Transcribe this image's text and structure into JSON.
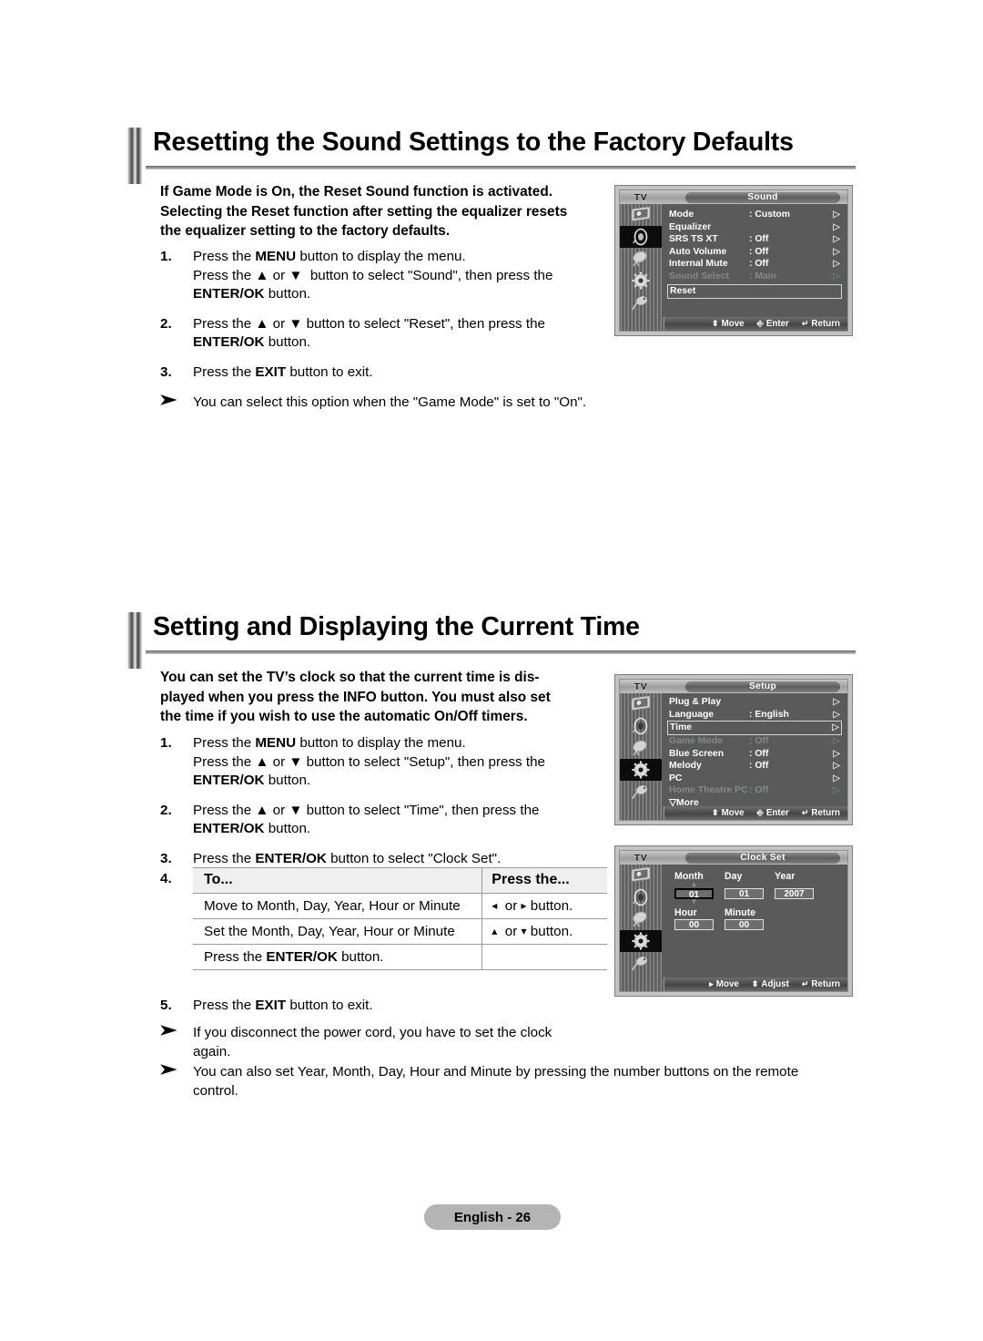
{
  "page": {
    "footer_label": "English - 26"
  },
  "sections": [
    {
      "title": "Resetting the Sound Settings to the Factory Defaults",
      "intro": "If Game Mode is On, the Reset Sound function is activated. Selecting the Reset function after setting the equalizer resets the equalizer setting to the factory defaults.",
      "steps": [
        {
          "num": "1.",
          "line1": "Press the MENU button to display the menu.",
          "line2": "Press the ▲ or ▼  button to select \"Sound\", then press the",
          "line3": "ENTER/OK button."
        },
        {
          "num": "2.",
          "line1": "Press the ▲ or ▼ button to select \"Reset\", then press the",
          "line2": "ENTER/OK button."
        },
        {
          "num": "3.",
          "line1": "Press the EXIT button to exit."
        }
      ],
      "notes": [
        "You can select this option when the \"Game Mode\" is set to \"On\"."
      ]
    },
    {
      "title": "Setting and Displaying the Current Time",
      "intro": "You can set the TV’s clock so that the current time is displayed when you press the INFO button. You must also set the time if you wish to use the automatic On/Off timers.",
      "steps": [
        {
          "num": "1.",
          "line1": "Press the MENU button to display the menu.",
          "line2": "Press the ▲ or ▼ button to select \"Setup\", then press the",
          "line3": "ENTER/OK button."
        },
        {
          "num": "2.",
          "line1": "Press the ▲ or ▼ button to select \"Time\", then press the",
          "line2": "ENTER/OK button."
        },
        {
          "num": "3.",
          "line1": "Press the ENTER/OK button to select \"Clock Set\"."
        },
        {
          "num": "4.",
          "line1": ""
        },
        {
          "num": "5.",
          "line1": "Press the EXIT button to exit."
        }
      ],
      "notes": [
        "If you disconnect the power cord, you have to set the clock again.",
        "You can also set Year, Month, Day, Hour and Minute by pressing the number buttons on the remote control."
      ]
    }
  ],
  "step_table": {
    "header": {
      "col1": "To...",
      "col2": "Press the..."
    },
    "rows": [
      {
        "col1": "Move to Month, Day, Year, Hour or Minute",
        "col2_pre": "◂",
        "col2_or": "or",
        "col2_post": "▸",
        "col2_tail": "button."
      },
      {
        "col1": "Set the Month, Day, Year, Hour or Minute",
        "col2_pre": "▴",
        "col2_or": "or",
        "col2_post": "▾",
        "col2_tail": "button."
      },
      {
        "col1": "Press the ENTER/OK button.",
        "col2_pre": "",
        "col2_or": "",
        "col2_post": "",
        "col2_tail": ""
      }
    ]
  },
  "osd_sound": {
    "tv_label": "TV",
    "title": "Sound",
    "rows": [
      {
        "label": "Mode",
        "value": ": Custom",
        "dim": false,
        "boxed": false
      },
      {
        "label": "Equalizer",
        "value": "",
        "dim": false,
        "boxed": false
      },
      {
        "label": "SRS TS XT",
        "value": ": Off",
        "dim": false,
        "boxed": false
      },
      {
        "label": "Auto Volume",
        "value": ": Off",
        "dim": false,
        "boxed": false
      },
      {
        "label": "Internal Mute",
        "value": ": Off",
        "dim": false,
        "boxed": false
      },
      {
        "label": "Sound Select",
        "value": ": Main",
        "dim": true,
        "boxed": false
      },
      {
        "label": "Reset",
        "value": "",
        "dim": false,
        "boxed": true
      }
    ],
    "footer": [
      {
        "icon": "⬍",
        "label": "Move"
      },
      {
        "icon": "⏎",
        "label": "Enter"
      },
      {
        "icon": "↶",
        "label": "Return"
      }
    ],
    "selected_rail_index": 1
  },
  "osd_setup": {
    "tv_label": "TV",
    "title": "Setup",
    "rows": [
      {
        "label": "Plug & Play",
        "value": "",
        "dim": false,
        "boxed": false
      },
      {
        "label": "Language",
        "value": ": English",
        "dim": false,
        "boxed": false
      },
      {
        "label": "Time",
        "value": "",
        "dim": false,
        "boxed": true
      },
      {
        "label": "Game Mode",
        "value": ": Off",
        "dim": true,
        "boxed": false
      },
      {
        "label": "Blue Screen",
        "value": ": Off",
        "dim": false,
        "boxed": false
      },
      {
        "label": "Melody",
        "value": ": Off",
        "dim": false,
        "boxed": false
      },
      {
        "label": "PC",
        "value": "",
        "dim": false,
        "boxed": false
      },
      {
        "label": "Home Theatre PC",
        "value": ": Off",
        "dim": true,
        "boxed": false
      },
      {
        "label": "▽More",
        "value": "",
        "dim": false,
        "boxed": false,
        "nochev": true
      }
    ],
    "footer": [
      {
        "icon": "⬍",
        "label": "Move"
      },
      {
        "icon": "⏎",
        "label": "Enter"
      },
      {
        "icon": "↶",
        "label": "Return"
      }
    ],
    "selected_rail_index": 3
  },
  "osd_clock": {
    "tv_label": "TV",
    "title": "Clock Set",
    "labels_row1": [
      "Month",
      "Day",
      "Year"
    ],
    "values_row1": [
      "01",
      "01",
      "2007"
    ],
    "labels_row2": [
      "Hour",
      "Minute"
    ],
    "values_row2": [
      "00",
      "00"
    ],
    "selected_field": "Month",
    "footer": [
      {
        "icon": "▸",
        "label": "Move"
      },
      {
        "icon": "⬍",
        "label": "Adjust"
      },
      {
        "icon": "↶",
        "label": "Return"
      }
    ],
    "selected_rail_index": 3
  },
  "colors": {
    "osd_bg": "#5a5a5a",
    "osd_frame": "#c3c3c3",
    "dim_text": "#7f8c85",
    "footer_pill": "#b4b4b4"
  }
}
